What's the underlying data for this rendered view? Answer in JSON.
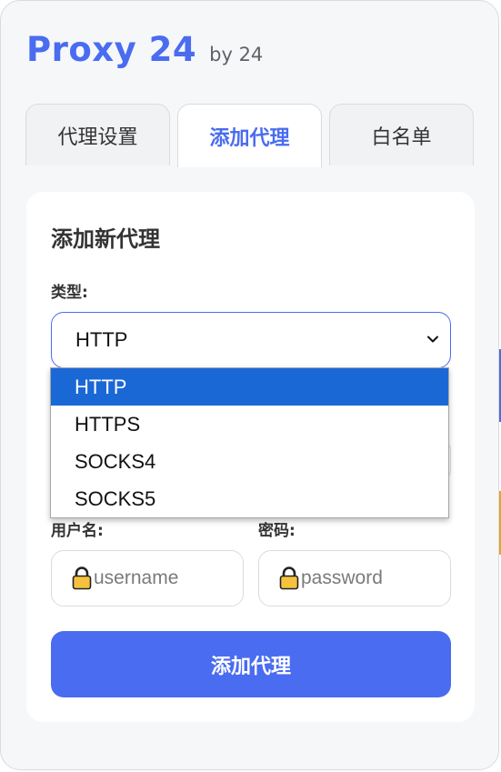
{
  "header": {
    "title": "Proxy 24",
    "by": "by 24"
  },
  "tabs": [
    {
      "label": "代理设置",
      "active": false
    },
    {
      "label": "添加代理",
      "active": true
    },
    {
      "label": "白名单",
      "active": false
    }
  ],
  "form": {
    "title": "添加新代理",
    "type_label": "类型:",
    "type_value": "HTTP",
    "username_label": "用户名:",
    "username_placeholder": "username",
    "password_label": "密码:",
    "password_placeholder": "password",
    "submit_label": "添加代理"
  },
  "dropdown": {
    "options": [
      "HTTP",
      "HTTPS",
      "SOCKS4",
      "SOCKS5"
    ],
    "selected": "HTTP"
  },
  "colors": {
    "accent": "#4a6cf0",
    "selected_option": "#1a68d6",
    "lock": "#f6c23e"
  },
  "icons": {
    "chevron": "chevron-down-icon",
    "lock": "lock-icon"
  }
}
